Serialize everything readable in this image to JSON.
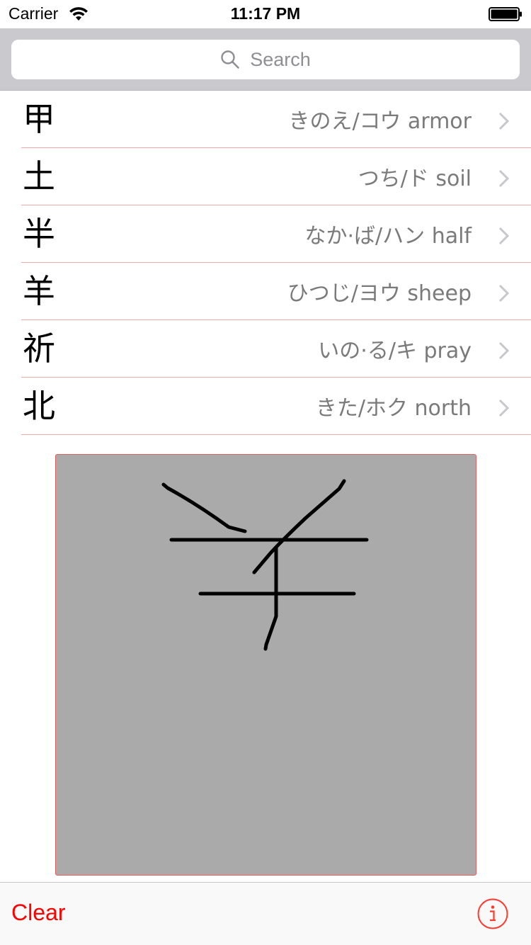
{
  "status_bar": {
    "carrier": "Carrier",
    "time": "11:17 PM"
  },
  "search": {
    "placeholder": "Search"
  },
  "kanji_list": [
    {
      "kanji": "甲",
      "reading": "きのえ/コウ armor"
    },
    {
      "kanji": "土",
      "reading": "つち/ド soil"
    },
    {
      "kanji": "半",
      "reading": "なか·ば/ハン half"
    },
    {
      "kanji": "羊",
      "reading": "ひつじ/ヨウ sheep"
    },
    {
      "kanji": "祈",
      "reading": "いの·る/キ pray"
    },
    {
      "kanji": "北",
      "reading": "きた/ホク north"
    }
  ],
  "toolbar": {
    "clear_label": "Clear"
  },
  "icons": {
    "search": "search-icon",
    "chevron": "chevron-right-icon",
    "info": "info-icon",
    "wifi": "wifi-icon",
    "battery": "battery-icon"
  },
  "colors": {
    "accent": "#ff0000",
    "separator": "#f0a8a8",
    "drawing_pad": "#aaaaaa",
    "search_bar_bg": "#c9c9ce"
  }
}
